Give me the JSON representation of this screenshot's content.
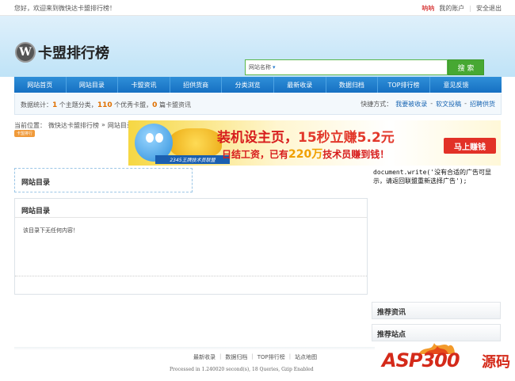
{
  "topbar": {
    "welcome": "您好，欢迎来到微快达卡盟排行榜！",
    "user": "呐呐",
    "account": "我的账户",
    "logout": "安全退出"
  },
  "logo": {
    "mark": "W",
    "name": "卡盟排行榜"
  },
  "search": {
    "select": "网站名称",
    "button": "搜 索"
  },
  "nav": [
    "网站首页",
    "网站目录",
    "卡盟资讯",
    "招供货商",
    "分类浏览",
    "最新收录",
    "数据归档",
    "TOP排行榜",
    "意见反馈"
  ],
  "stats": {
    "label": "数据统计：",
    "n1": "1",
    "t1": " 个主题分类，",
    "n2": "110",
    "t2": " 个优秀卡盟，",
    "n3": "0",
    "t3": " 篇卡盟资讯",
    "shortcut": "快捷方式：",
    "l1": "我要被收录",
    "l2": "软文投稿",
    "l3": "招聘供货"
  },
  "breadcrumb": {
    "label": "当前位置：",
    "home": "微快达卡盟排行榜",
    "sep": "»",
    "current": "网站目录",
    "tag": "卡盟排行"
  },
  "banner": {
    "line1a": "装机设主页，",
    "line1b": "15秒立赚5.2元",
    "line2a": "日结工资，已有",
    "line2b": "220万",
    "line2c": "技术员赚到钱！",
    "strip": "2345王牌技术员联盟",
    "cta": "马上赚钱"
  },
  "boxtop_title": "网站目录",
  "main": {
    "title": "网站目录",
    "empty": "该目录下无任何内容！"
  },
  "code": "document.write('没有合适的广告可显示，请返回联盟重新选择广告');",
  "sidebar": {
    "recommend_news": "推荐资讯",
    "recommend_sites": "推荐站点"
  },
  "footer": {
    "links": [
      "最新收录",
      "数据归档",
      "TOP排行榜",
      "站点地图"
    ],
    "processed": "Processed in 1.240020 second(s), 18 Queries, Gzip Enabled"
  },
  "watermark": {
    "asp": "ASP300",
    "ym": "源码"
  }
}
